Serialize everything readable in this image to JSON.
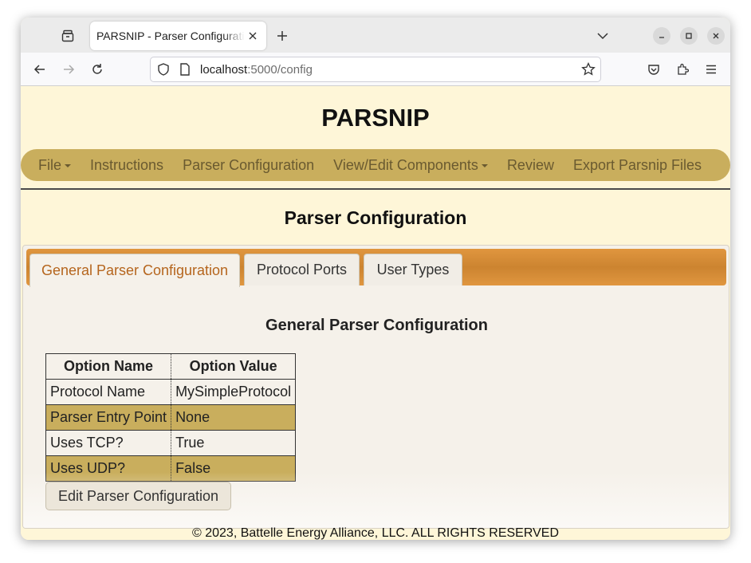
{
  "browser": {
    "tab_title": "PARSNIP - Parser Configuration",
    "url_host": "localhost",
    "url_path": ":5000/config"
  },
  "app": {
    "title": "PARSNIP",
    "nav": {
      "file": "File",
      "instructions": "Instructions",
      "parser_configuration": "Parser Configuration",
      "view_edit_components": "View/Edit Components",
      "review": "Review",
      "export": "Export Parsnip Files"
    },
    "page_title": "Parser Configuration"
  },
  "config_tabs": {
    "general": "General Parser Configuration",
    "protocol_ports": "Protocol Ports",
    "user_types": "User Types",
    "active": "general"
  },
  "general": {
    "section_title": "General Parser Configuration",
    "table": {
      "headers": [
        "Option Name",
        "Option Value"
      ],
      "rows": [
        [
          "Protocol Name",
          "MySimpleProtocol"
        ],
        [
          "Parser Entry Point",
          "None"
        ],
        [
          "Uses TCP?",
          "True"
        ],
        [
          "Uses UDP?",
          "False"
        ]
      ]
    },
    "edit_button": "Edit Parser Configuration"
  },
  "footer": "© 2023, Battelle Energy Alliance, LLC. ALL RIGHTS RESERVED",
  "colors": {
    "page_bg": "#fef6d8",
    "nav_bg": "#c9ae5d",
    "tab_bar": "#cc8430",
    "active_tab_text": "#b5651d"
  }
}
